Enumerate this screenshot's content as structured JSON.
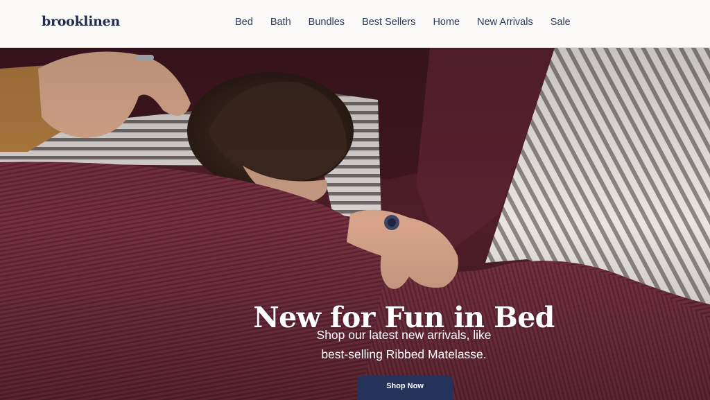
{
  "header": {
    "logo": "brooklinen",
    "nav": [
      "Bed",
      "Bath",
      "Bundles",
      "Best Sellers",
      "Home",
      "New Arrivals",
      "Sale"
    ]
  },
  "hero": {
    "image_description_icon": "hero-photo",
    "title": "New for Fun in Bed",
    "subtitle_lines": [
      "Shop our latest new arrivals, like",
      "best-selling Ribbed Matelasse."
    ],
    "cta_label": "Shop Now"
  },
  "colors": {
    "brand_navy": "#1e2c4f",
    "button_navy": "#25335a",
    "burgundy": "#6b2b37",
    "header_bg": "#fbfaf8"
  }
}
